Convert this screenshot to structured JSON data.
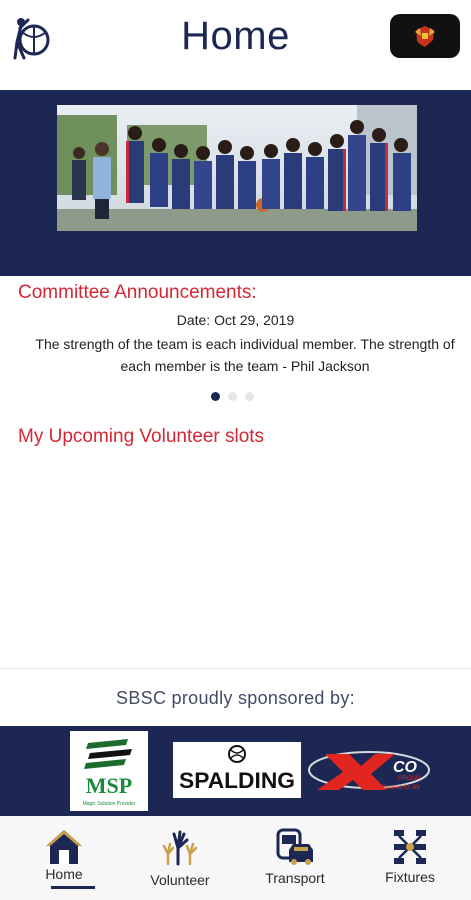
{
  "header": {
    "title": "Home",
    "logo_icon": "basketball-player-logo",
    "crest_icon": "club-crest-icon"
  },
  "banner": {
    "image": "team-photo"
  },
  "announcements": {
    "heading": "Committee Announcements:",
    "date": "Date: Oct 29, 2019",
    "text": "The strength of the team is each individual member. The strength of each member is the team - Phil Jackson",
    "page_count": 3,
    "active_page": 1
  },
  "volunteer": {
    "heading": "My Upcoming Volunteer slots"
  },
  "sponsors": {
    "caption": "SBSC proudly sponsored by:",
    "logos": [
      {
        "name": "MSP",
        "subtitle": "Magic Solution Provider"
      },
      {
        "name": "SPALDING"
      },
      {
        "name": "XCO",
        "subtitle": "GROUP",
        "tagline": "Geared for life"
      }
    ]
  },
  "nav": {
    "items": [
      {
        "label": "Home",
        "icon": "home-icon",
        "active": true
      },
      {
        "label": "Volunteer",
        "icon": "raised-hands-icon",
        "active": false
      },
      {
        "label": "Transport",
        "icon": "bus-car-icon",
        "active": false
      },
      {
        "label": "Fixtures",
        "icon": "bracket-icon",
        "active": false
      }
    ]
  },
  "colors": {
    "navy": "#1c2754",
    "accent_red": "#d42736",
    "gold": "#c9a14a",
    "nav_bg": "#f7f7f7"
  }
}
